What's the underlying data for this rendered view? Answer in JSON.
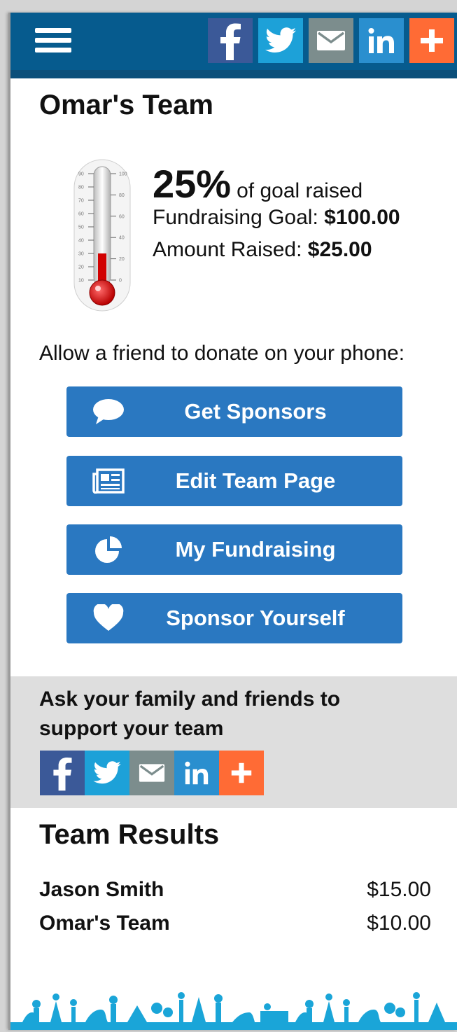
{
  "colors": {
    "header": "#065b8e",
    "button": "#2a78c1",
    "facebook": "#3b5998",
    "twitter": "#1da1d8",
    "email": "#7c8d8d",
    "linkedin": "#2a8fcf",
    "plus": "#ff6b35",
    "panel": "#dedede"
  },
  "header": {
    "menu_icon": "hamburger-menu-icon",
    "share": [
      "facebook-icon",
      "twitter-icon",
      "email-icon",
      "linkedin-icon",
      "plus-icon"
    ]
  },
  "team": {
    "title": "Omar's Team",
    "progress_fraction": 0.25,
    "percent": "25%",
    "percent_suffix": "of goal raised",
    "goal_label": "Fundraising Goal:",
    "goal_value": "$100.00",
    "raised_label": "Amount Raised:",
    "raised_value": "$25.00",
    "thermometer_left_ticks": [
      "90",
      "80",
      "70",
      "60",
      "50",
      "40",
      "30",
      "20",
      "10"
    ],
    "thermometer_right_ticks": [
      "100",
      "80",
      "60",
      "40",
      "20",
      "0"
    ]
  },
  "allow_text": "Allow a friend to donate on your phone:",
  "buttons": [
    {
      "label": "Get Sponsors",
      "icon": "speech-bubble-icon"
    },
    {
      "label": "Edit Team Page",
      "icon": "newspaper-icon"
    },
    {
      "label": "My Fundraising",
      "icon": "pie-chart-icon"
    },
    {
      "label": "Sponsor Yourself",
      "icon": "heart-icon"
    }
  ],
  "ask": {
    "text": "Ask your family and friends to support your team"
  },
  "results": {
    "title": "Team Results",
    "rows": [
      {
        "name": "Jason Smith",
        "amount": "$15.00"
      },
      {
        "name": "Omar's Team",
        "amount": "$10.00"
      }
    ]
  }
}
